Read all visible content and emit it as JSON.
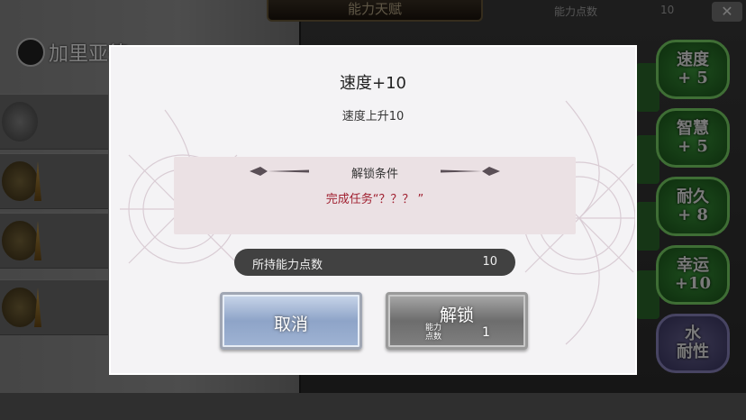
{
  "background": {
    "top_banner": "能力天赋",
    "points_label": "能力点数",
    "points_value": "10",
    "close_icon": "close-icon",
    "hero_name": "加里亚德",
    "side_label": "加",
    "skill_nodes": [
      {
        "text": "速度\n+ 5"
      },
      {
        "text": "智慧\n+ 5"
      },
      {
        "text": "耐久\n+ 8"
      },
      {
        "text": "幸运\n+10"
      },
      {
        "text": "水\n耐性"
      }
    ]
  },
  "dialog": {
    "title": "速度+10",
    "description": "速度上升10",
    "condition_title": "解锁条件",
    "condition_text": "完成任务“？？？ ”",
    "points_label": "所持能力点数",
    "points_value": "10",
    "cancel_label": "取消",
    "unlock_label": "解锁",
    "cost_label": "能力\n点数",
    "cost_value": "1"
  },
  "colors": {
    "condition_text": "#a02030",
    "dialog_bg": "#f4f3f5",
    "skill_green": "#3c9b3c"
  }
}
